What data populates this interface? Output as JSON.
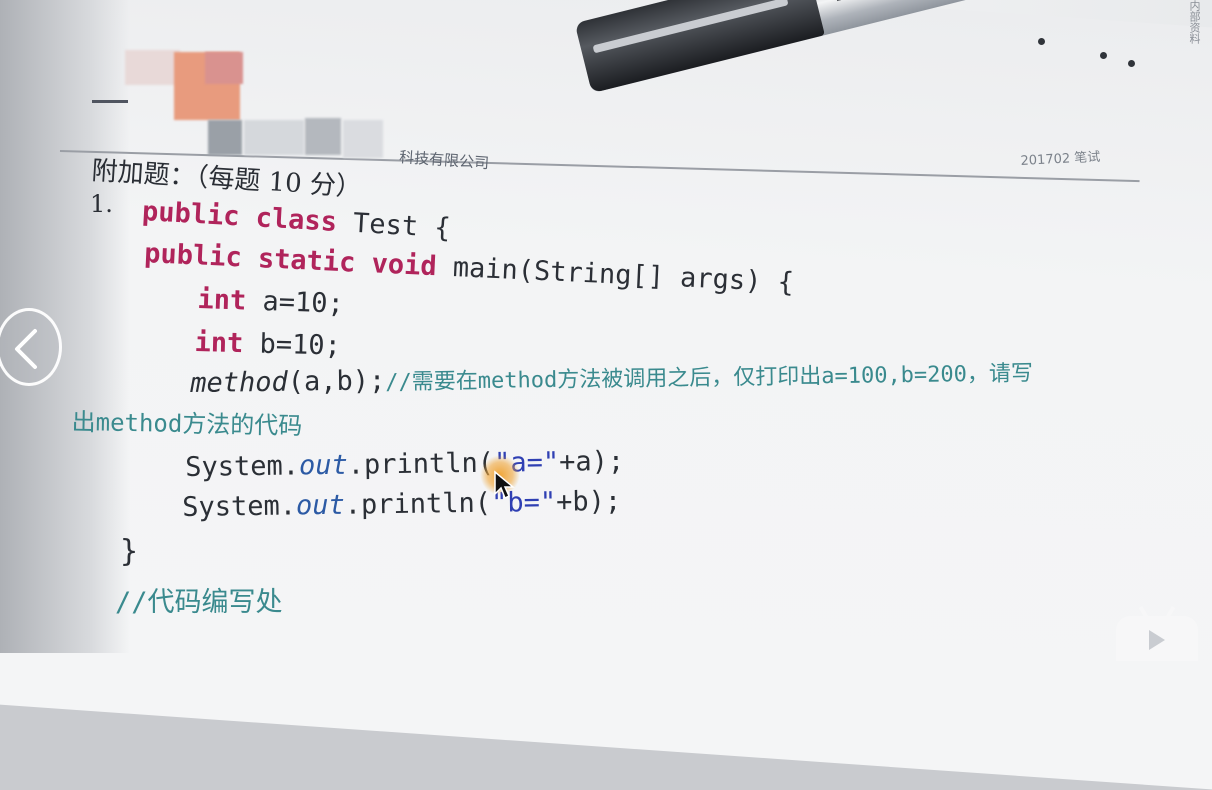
{
  "header": {
    "company_suffix": "科技有限公司",
    "doc_code": "201702 笔试",
    "side_label": "内部资料"
  },
  "question": {
    "section_title": "附加题：（每题 10 分）",
    "number": "1.",
    "code_lines": {
      "l1_kw": "public class",
      "l1_rest": " Test {",
      "l2_kw": "public static void",
      "l2_rest": " main(String[] args) {",
      "l3_kw": "int",
      "l3_rest": " a=10;",
      "l4_kw": "int",
      "l4_rest": " b=10;",
      "l5_method": "method",
      "l5_rest": "(a,b);",
      "l5_comment": "//需要在method方法被调用之后，仅打印出a=100,b=200，请写",
      "l5_comment_cont": "出method方法的代码",
      "l6_sys": "System.",
      "l6_out": "out",
      "l6_call": ".println(",
      "l6_str": "\"a=\"",
      "l6_end": "+a);",
      "l7_sys": "System.",
      "l7_out": "out",
      "l7_call": ".println(",
      "l7_str": "\"b=\"",
      "l7_end": "+b);",
      "l8": "}",
      "l9_comment": "//代码编写处"
    }
  },
  "overlay": {
    "back_icon": "chevron-left-icon",
    "cursor_icon": "mouse-pointer-icon",
    "tv_icon": "bilibili-tv-icon"
  }
}
